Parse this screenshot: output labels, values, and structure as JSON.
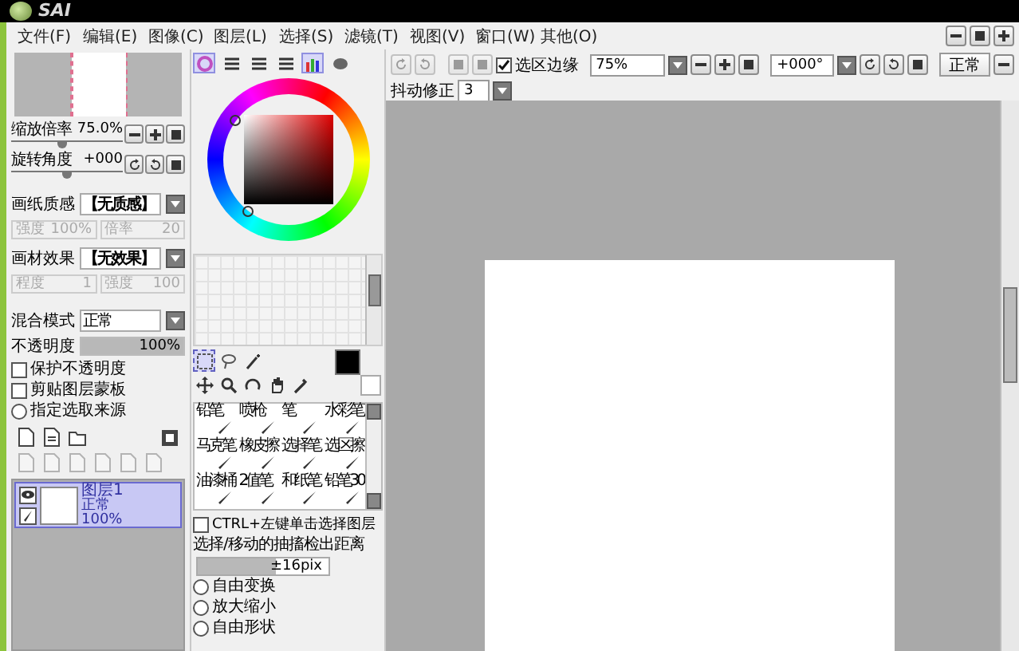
{
  "title_bar": {
    "logo": "SAI"
  },
  "menu": [
    "文件(F)",
    "编辑(E)",
    "图像(C)",
    "图层(L)",
    "选择(S)",
    "滤镜(T)",
    "视图(V)",
    "窗口(W)",
    "其他(O)"
  ],
  "navigator": {
    "zoom": {
      "label": "缩放倍率",
      "value": "75.0%",
      "level": 0.45
    },
    "rotate": {
      "label": "旋转角度",
      "value": "+000",
      "level": 0.5
    }
  },
  "paper": [
    {
      "label": "画纸质感",
      "value": "【无质感】",
      "fields": [
        {
          "label": "强度",
          "value": "100%"
        },
        {
          "label": "倍率",
          "value": "20"
        }
      ]
    },
    {
      "label": "画材效果",
      "value": "【无效果】",
      "fields": [
        {
          "label": "程度",
          "value": "1"
        },
        {
          "label": "强度",
          "value": "100"
        }
      ]
    }
  ],
  "layer_props": {
    "blend_label": "混合模式",
    "blend_value": "正常",
    "opacity": {
      "label": "不透明度",
      "value": "100%",
      "level": 1.0
    },
    "options": [
      {
        "kind": "checkbox",
        "label": "保护不透明度",
        "checked": false
      },
      {
        "kind": "checkbox",
        "label": "剪贴图层蒙板",
        "checked": false
      },
      {
        "kind": "radio",
        "label": "指定选取来源",
        "checked": false
      }
    ]
  },
  "layers": [
    {
      "name": "图层1",
      "mode": "正常",
      "opacity": "100%",
      "selected": true,
      "visible": true
    }
  ],
  "color_modes": [
    {
      "selected": true
    },
    {
      "selected": false
    },
    {
      "selected": false
    },
    {
      "selected": false
    },
    {
      "selected": true
    },
    {
      "selected": false
    }
  ],
  "brushes": [
    {
      "label": "铅笔",
      "selected": false
    },
    {
      "label": "喷枪",
      "selected": false
    },
    {
      "label": "笔",
      "selected": false
    },
    {
      "label": "水彩笔",
      "selected": false
    },
    {
      "label": "马克笔",
      "selected": false
    },
    {
      "label": "橡皮擦",
      "selected": false
    },
    {
      "label": "选择笔",
      "selected": false
    },
    {
      "label": "选区擦",
      "selected": false
    },
    {
      "label": "油漆桶",
      "selected": false
    },
    {
      "label": "2值笔",
      "selected": false
    },
    {
      "label": "和纸笔",
      "selected": false
    },
    {
      "label": "铅笔30",
      "selected": false
    }
  ],
  "tool_options": {
    "ctrl_label": "CTRL+左键单击选择图层",
    "ctrl_checked": false,
    "distance": {
      "label": "选择/移动的抽搐检出距离",
      "value": "±16pix",
      "level": 0.6
    },
    "modes": [
      {
        "label": "自由变换",
        "selected": false
      },
      {
        "label": "放大缩小",
        "selected": false
      },
      {
        "label": "自由形状",
        "selected": false
      }
    ]
  },
  "toolbar": {
    "edge_label": "选区边缘",
    "edge_checked": true,
    "zoom": "75%",
    "rotation": "+000°",
    "mode": "正常",
    "stabilizer_label": "抖动修正",
    "stabilizer": "3"
  }
}
